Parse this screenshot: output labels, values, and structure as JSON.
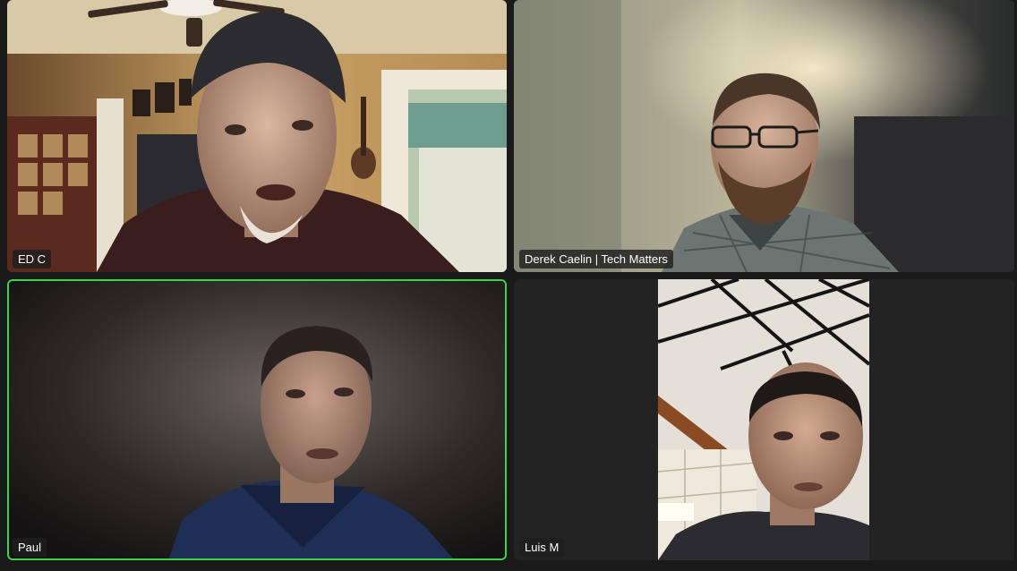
{
  "meeting": {
    "participants": [
      {
        "name": "ED C"
      },
      {
        "name": "Derek Caelin | Tech Matters"
      },
      {
        "name": "Paul"
      },
      {
        "name": "Luis M"
      }
    ],
    "active_speaker": "Paul"
  },
  "colors": {
    "background": "#1a1a1a",
    "active_speaker_border": "#3fd24a",
    "name_tag_bg": "#1e1e1e",
    "name_tag_text": "#ffffff"
  }
}
